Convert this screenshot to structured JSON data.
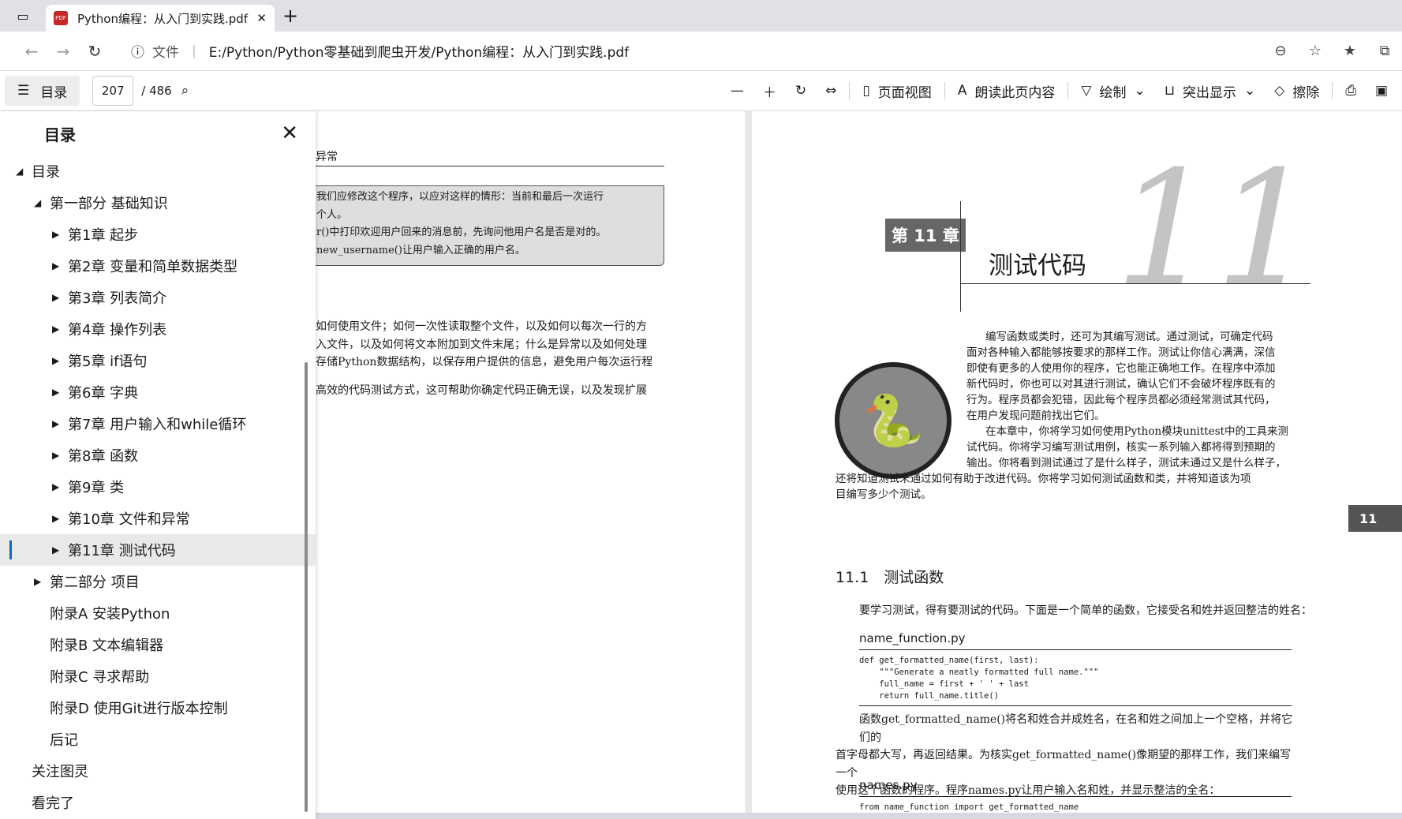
{
  "tab": {
    "title": "Python编程：从入门到实践.pdf",
    "pdf": "PDF",
    "close": "✕",
    "new": "+"
  },
  "address": {
    "file_label": "文件",
    "sep": "|",
    "url": "E:/Python/Python零基础到爬虫开发/Python编程：从入门到实践.pdf"
  },
  "toolbar": {
    "toc": "目录",
    "page": "207",
    "total": "/ 486",
    "page_view": "页面视图",
    "read_aloud": "朗读此页内容",
    "draw": "绘制",
    "highlight": "突出显示",
    "erase": "擦除"
  },
  "sidebar": {
    "title": "目录",
    "items": [
      {
        "label": "目录",
        "indent": 0,
        "tri": "◢"
      },
      {
        "label": "第一部分 基础知识",
        "indent": 1,
        "tri": "◢"
      },
      {
        "label": "第1章 起步",
        "indent": 2,
        "tri": "▶"
      },
      {
        "label": "第2章 变量和简单数据类型",
        "indent": 2,
        "tri": "▶"
      },
      {
        "label": "第3章 列表简介",
        "indent": 2,
        "tri": "▶"
      },
      {
        "label": "第4章 操作列表",
        "indent": 2,
        "tri": "▶"
      },
      {
        "label": "第5章 if语句",
        "indent": 2,
        "tri": "▶"
      },
      {
        "label": "第6章 字典",
        "indent": 2,
        "tri": "▶"
      },
      {
        "label": "第7章 用户输入和while循环",
        "indent": 2,
        "tri": "▶"
      },
      {
        "label": "第8章 函数",
        "indent": 2,
        "tri": "▶"
      },
      {
        "label": "第9章 类",
        "indent": 2,
        "tri": "▶"
      },
      {
        "label": "第10章 文件和异常",
        "indent": 2,
        "tri": "▶"
      },
      {
        "label": "第11章 测试代码",
        "indent": 2,
        "tri": "▶",
        "selected": true
      },
      {
        "label": "第二部分 项目",
        "indent": 1,
        "tri": "▶"
      },
      {
        "label": "附录A 安装Python",
        "indent": 1,
        "tri": ""
      },
      {
        "label": "附录B 文本编辑器",
        "indent": 1,
        "tri": ""
      },
      {
        "label": "附录C 寻求帮助",
        "indent": 1,
        "tri": ""
      },
      {
        "label": "附录D 使用Git进行版本控制",
        "indent": 1,
        "tri": ""
      },
      {
        "label": "后记",
        "indent": 1,
        "tri": ""
      },
      {
        "label": "关注图灵",
        "indent": 0,
        "tri": ""
      },
      {
        "label": "看完了",
        "indent": 0,
        "tri": ""
      }
    ]
  },
  "left_page": {
    "header": "异常",
    "box": [
      "我们应修改这个程序，以应对这样的情形：当前和最后一次运行",
      "个人。",
      "r()中打印欢迎用户回来的消息前，先询问他用户名是否是对的。",
      "new_username()让用户输入正确的用户名。"
    ],
    "body": [
      "如何使用文件；如何一次性读取整个文件，以及如何以每次一行的方",
      "入文件，以及如何将文本附加到文件末尾；什么是异常以及如何处理",
      "存储Python数据结构，以保存用户提供的信息，避免用户每次运行程",
      "",
      "高效的代码测试方式，这可帮助你确定代码正确无误，以及发现扩展"
    ]
  },
  "right_page": {
    "chapter_tag": "第 11 章",
    "chapter_title": "测试代码",
    "big_number": "11",
    "side_tag": "11",
    "intro": [
      "编写函数或类时，还可为其编写测试。通过测试，可确定代码",
      "面对各种输入都能够按要求的那样工作。测试让你信心满满，深信",
      "即使有更多的人使用你的程序，它也能正确地工作。在程序中添加",
      "新代码时，你也可以对其进行测试，确认它们不会破坏程序既有的",
      "行为。程序员都会犯错，因此每个程序员都必须经常测试其代码，",
      "在用户发现问题前找出它们。",
      "在本章中，你将学习如何使用Python模块unittest中的工具来测",
      "试代码。你将学习编写测试用例，核实一系列输入都将得到预期的",
      "输出。你将看到测试通过了是什么样子，测试未通过又是什么样子，",
      "还将知道测试未通过如何有助于改进代码。你将学习如何测试函数和类，并将知道该为项",
      "目编写多少个测试。"
    ],
    "section": "11.1　测试函数",
    "p1": "要学习测试，得有要测试的代码。下面是一个简单的函数，它接受名和姓并返回整洁的姓名：",
    "file1": "name_function.py",
    "code1": "def get_formatted_name(first, last):\n    \"\"\"Generate a neatly formatted full name.\"\"\"\n    full_name = first + ' ' + last\n    return full_name.title()",
    "p2": [
      "函数get_formatted_name()将名和姓合并成姓名，在名和姓之间加上一个空格，并将它们的",
      "首字母都大写，再返回结果。为核实get_formatted_name()像期望的那样工作，我们来编写一个",
      "使用这个函数的程序。程序names.py让用户输入名和姓，并显示整洁的全名："
    ],
    "file2": "names.py",
    "code2": "from name_function import get_formatted_name"
  }
}
